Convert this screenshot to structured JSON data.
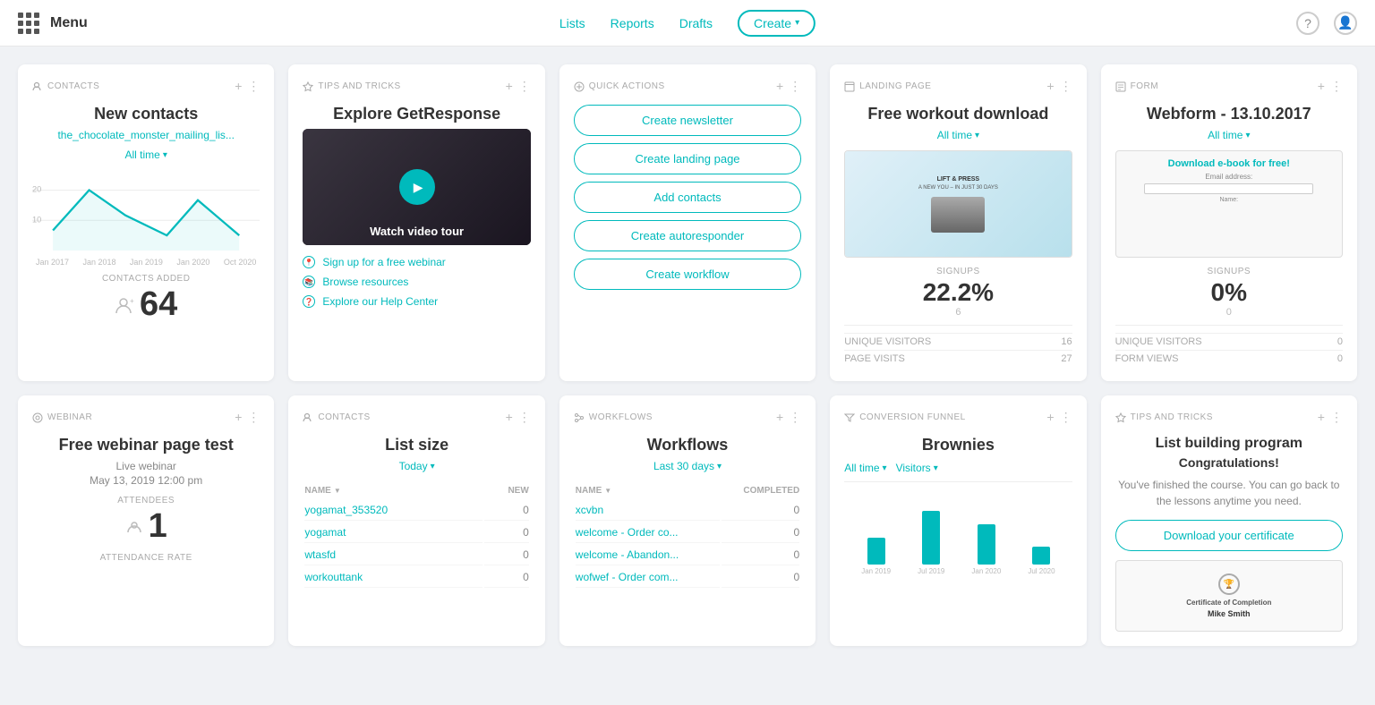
{
  "nav": {
    "menu_label": "Menu",
    "links": [
      "Lists",
      "Reports",
      "Drafts"
    ],
    "create_btn": "Create"
  },
  "cards": {
    "contacts": {
      "tag": "Contacts",
      "title": "New contacts",
      "list_link": "the_chocolate_monster_mailing_lis...",
      "alltime": "All time",
      "chart_y_labels": [
        "20",
        "10"
      ],
      "chart_x_labels": [
        "Jan 2017",
        "Jan 2018",
        "Jan 2019",
        "Jan 2020",
        "Oct 2020"
      ],
      "contacts_added_label": "CONTACTS ADDED",
      "contacts_added_value": "64"
    },
    "tips": {
      "tag": "Tips and Tricks",
      "title": "Explore GetResponse",
      "video_label": "Watch video tour",
      "links": [
        "Sign up for a free webinar",
        "Browse resources",
        "Explore our Help Center"
      ]
    },
    "quick_actions": {
      "tag": "Quick Actions",
      "buttons": [
        "Create newsletter",
        "Create landing page",
        "Add contacts",
        "Create autoresponder",
        "Create workflow"
      ]
    },
    "landing_page": {
      "tag": "Landing Page",
      "title": "Free workout download",
      "alltime": "All time",
      "signups_label": "SIGNUPS",
      "signups_value": "22.2%",
      "signups_count": "6",
      "unique_visitors_label": "UNIQUE VISITORS",
      "unique_visitors_value": "16",
      "page_visits_label": "PAGE VISITS",
      "page_visits_value": "27"
    },
    "form": {
      "tag": "Form",
      "title": "Webform - 13.10.2017",
      "alltime": "All time",
      "form_title": "Download e-book for free!",
      "email_label": "Email address:",
      "signups_label": "SIGNUPS",
      "signups_value": "0%",
      "signups_count": "0",
      "unique_visitors_label": "UNIQUE VISITORS",
      "unique_visitors_value": "0",
      "form_views_label": "FORM VIEWS",
      "form_views_value": "0"
    },
    "webinar": {
      "tag": "Webinar",
      "title": "Free webinar page test",
      "type": "Live webinar",
      "date": "May 13, 2019 12:00 pm",
      "attendees_label": "ATTENDEES",
      "attendees_value": "1",
      "attendance_rate_label": "ATTENDANCE RATE"
    },
    "list_size": {
      "tag": "Contacts",
      "title": "List size",
      "filter": "Today",
      "columns": [
        "NAME",
        "NEW"
      ],
      "rows": [
        {
          "name": "yogamat_353520",
          "new": "0"
        },
        {
          "name": "yogamat",
          "new": "0"
        },
        {
          "name": "wtasfd",
          "new": "0"
        },
        {
          "name": "workouttank",
          "new": "0"
        }
      ]
    },
    "workflows": {
      "tag": "Workflows",
      "title": "Workflows",
      "filter": "Last 30 days",
      "columns": [
        "NAME",
        "COMPLETED"
      ],
      "rows": [
        {
          "name": "xcvbn",
          "completed": "0"
        },
        {
          "name": "welcome - Order co...",
          "completed": "0"
        },
        {
          "name": "welcome - Abandon...",
          "completed": "0"
        },
        {
          "name": "wofwef - Order com...",
          "completed": "0"
        }
      ]
    },
    "funnel": {
      "tag": "Conversion Funnel",
      "title": "Brownies",
      "alltime": "All time",
      "visitors_filter": "Visitors",
      "chart_labels": [
        "Jan 2019",
        "Jul 2019",
        "Jan 2020",
        "Jul 2020"
      ],
      "chart_bars": [
        30,
        60,
        45,
        20
      ]
    },
    "bottom_tips": {
      "tag": "Tips and Tricks",
      "title": "List building program",
      "subtitle": "Congratulations!",
      "body": "You've finished the course. You can go back to the lessons anytime you need.",
      "cert_btn": "Download your certificate",
      "cert_label": "Certificate of Completion",
      "cert_name": "Mike Smith"
    }
  }
}
